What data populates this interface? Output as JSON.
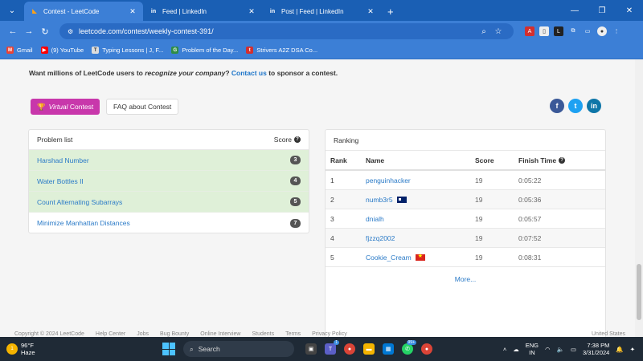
{
  "browser": {
    "tabs": [
      {
        "title": "Contest - LeetCode",
        "icon": "leetcode-icon",
        "active": true
      },
      {
        "title": "Feed | LinkedIn",
        "icon": "linkedin-icon",
        "active": false
      },
      {
        "title": "Post | Feed | LinkedIn",
        "icon": "linkedin-icon",
        "active": false
      }
    ],
    "url": "leetcode.com/contest/weekly-contest-391/",
    "bookmarks": [
      {
        "label": "Gmail",
        "icon": "gmail-icon"
      },
      {
        "label": "(9) YouTube",
        "icon": "youtube-icon"
      },
      {
        "label": "Typing Lessons | J, F...",
        "icon": "typing-icon"
      },
      {
        "label": "Problem of the Day...",
        "icon": "gfg-icon"
      },
      {
        "label": "Strivers A2Z DSA Co...",
        "icon": "tuf-icon"
      }
    ]
  },
  "sponsor": {
    "lead": "Want millions of LeetCode users to ",
    "emph": "recognize your company",
    "mid": "? ",
    "link": "Contact us",
    "tail": " to sponsor a contest."
  },
  "buttons": {
    "virtual_prefix": "Virtual",
    "virtual_suffix": " Contest",
    "faq": "FAQ about Contest"
  },
  "problems": {
    "header": "Problem list",
    "score_header": "Score",
    "items": [
      {
        "name": "Harshad Number",
        "score": "3",
        "solved": true
      },
      {
        "name": "Water Bottles II",
        "score": "4",
        "solved": true
      },
      {
        "name": "Count Alternating Subarrays",
        "score": "5",
        "solved": true
      },
      {
        "name": "Minimize Manhattan Distances",
        "score": "7",
        "solved": false
      }
    ]
  },
  "ranking": {
    "title": "Ranking",
    "columns": {
      "rank": "Rank",
      "name": "Name",
      "score": "Score",
      "time": "Finish Time"
    },
    "rows": [
      {
        "rank": "1",
        "name": "penguinhacker",
        "score": "19",
        "time": "0:05:22",
        "flag": ""
      },
      {
        "rank": "2",
        "name": "numb3r5",
        "score": "19",
        "time": "0:05:36",
        "flag": "au"
      },
      {
        "rank": "3",
        "name": "dnialh",
        "score": "19",
        "time": "0:05:57",
        "flag": ""
      },
      {
        "rank": "4",
        "name": "fjzzq2002",
        "score": "19",
        "time": "0:07:52",
        "flag": ""
      },
      {
        "rank": "5",
        "name": "Cookie_Cream",
        "score": "19",
        "time": "0:08:31",
        "flag": "vn"
      }
    ],
    "more": "More..."
  },
  "footer": {
    "copyright": "Copyright © 2024 LeetCode",
    "links": [
      "Help Center",
      "Jobs",
      "Bug Bounty",
      "Online Interview",
      "Students",
      "Terms",
      "Privacy Policy"
    ],
    "region": "United States"
  },
  "taskbar": {
    "temp": "96°F",
    "condition": "Haze",
    "search": "Search",
    "lang1": "ENG",
    "lang2": "IN",
    "time": "7:38 PM",
    "date": "3/31/2024"
  }
}
